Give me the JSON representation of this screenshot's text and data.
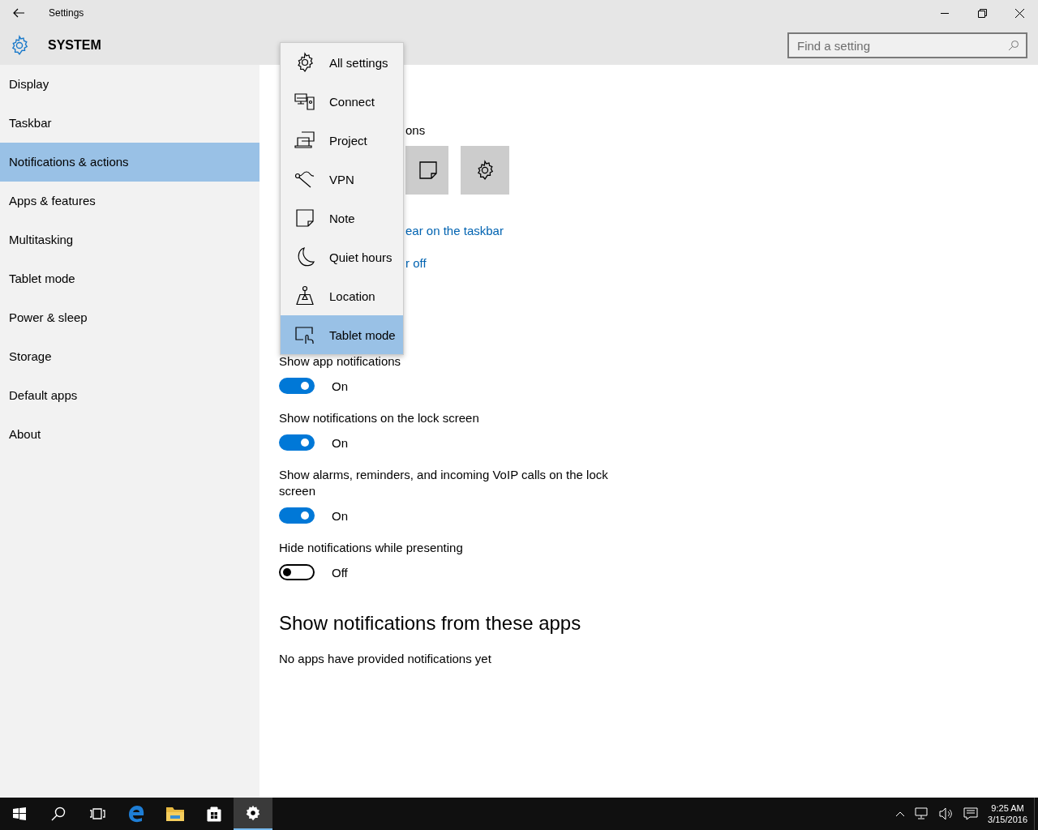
{
  "window": {
    "title": "Settings"
  },
  "header": {
    "section": "SYSTEM",
    "search": {
      "placeholder": "Find a setting"
    }
  },
  "sidebar": {
    "items": [
      {
        "label": "Display",
        "selected": false
      },
      {
        "label": "Taskbar",
        "selected": false
      },
      {
        "label": "Notifications & actions",
        "selected": true
      },
      {
        "label": "Apps & features",
        "selected": false
      },
      {
        "label": "Multitasking",
        "selected": false
      },
      {
        "label": "Tablet mode",
        "selected": false
      },
      {
        "label": "Power & sleep",
        "selected": false
      },
      {
        "label": "Storage",
        "selected": false
      },
      {
        "label": "Default apps",
        "selected": false
      },
      {
        "label": "About",
        "selected": false
      }
    ]
  },
  "quick_actions_menu": {
    "items": [
      {
        "label": "All settings",
        "selected": false
      },
      {
        "label": "Connect",
        "selected": false
      },
      {
        "label": "Project",
        "selected": false
      },
      {
        "label": "VPN",
        "selected": false
      },
      {
        "label": "Note",
        "selected": false
      },
      {
        "label": "Quiet hours",
        "selected": false
      },
      {
        "label": "Location",
        "selected": false
      },
      {
        "label": "Tablet mode",
        "selected": true
      }
    ]
  },
  "content": {
    "subheading": "ons",
    "links": [
      "ear on the taskbar",
      "r off"
    ],
    "toggles": [
      {
        "label": "Show app notifications",
        "on": true,
        "state": "On"
      },
      {
        "label": "Show notifications on the lock screen",
        "on": true,
        "state": "On"
      },
      {
        "label": "Show alarms, reminders, and incoming VoIP calls on the lock screen",
        "on": true,
        "state": "On"
      },
      {
        "label": "Hide notifications while presenting",
        "on": false,
        "state": "Off"
      }
    ],
    "apps_heading": "Show notifications from these apps",
    "apps_empty": "No apps have provided notifications yet"
  },
  "taskbar": {
    "apps": [
      {
        "selected": false
      },
      {
        "selected": false
      },
      {
        "selected": false
      },
      {
        "selected": false
      },
      {
        "selected": false
      },
      {
        "selected": false
      },
      {
        "selected": true
      }
    ],
    "clock": {
      "time": "9:25 AM",
      "date": "3/15/2016"
    }
  }
}
